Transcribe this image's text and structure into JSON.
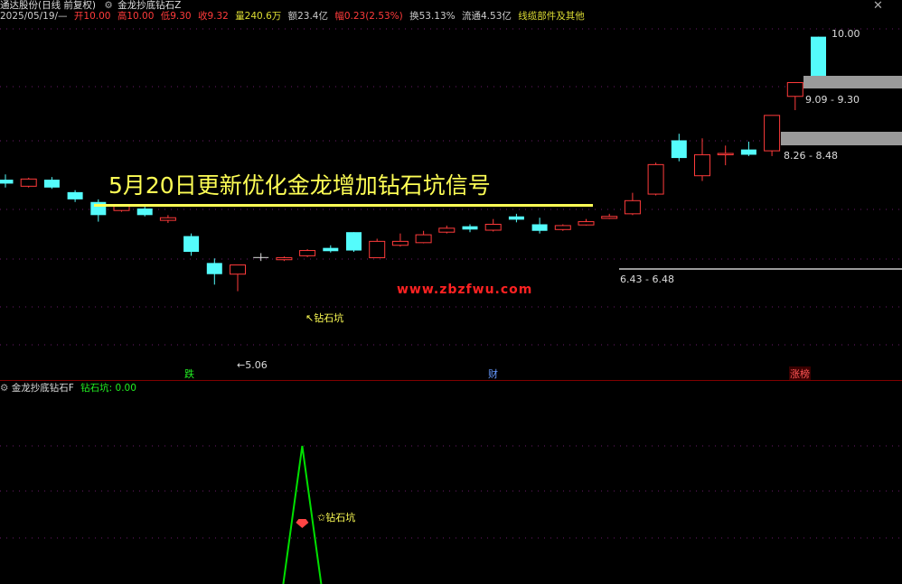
{
  "header": {
    "title_left": "通达股份(日线 前复权)",
    "indicator_name": "金龙抄底钻石Z",
    "date": "2025/05/19/—",
    "open": "开10.00",
    "high": "高10.00",
    "low": "低9.30",
    "close": "收9.32",
    "volume": "量240.6万",
    "amount": "额23.4亿",
    "change": "幅0.23(2.53%)",
    "turnover": "换53.13%",
    "float": "流通4.53亿",
    "industry": "线缆部件及其他"
  },
  "banner": "5月20日更新优化金龙增加钻石坑信号",
  "watermark": "www.zbzfwu.com",
  "price_labels": {
    "high_price": "10.00",
    "range_top": "9.09 - 9.30",
    "range_mid": "8.26 - 8.48",
    "range_low": "6.43 - 6.48",
    "low_price": "←5.06"
  },
  "signal_label": "钻石坑",
  "event_markers": {
    "die": "跌",
    "cai": "财",
    "zhangbang": "涨榜"
  },
  "lower_panel": {
    "name": "金龙抄底钻石F",
    "value": "钻石坑: 0.00",
    "signal_label": "钻石坑"
  },
  "colors": {
    "up": "#ff3b3b",
    "down": "#54fcfc",
    "gold": "#ffff55",
    "indicator_line": "#00e000",
    "separator": "#800000"
  },
  "chart_data": {
    "type": "candlestick",
    "candles": [
      {
        "open": 7.82,
        "close": 7.76,
        "high": 7.9,
        "low": 7.7
      },
      {
        "open": 7.72,
        "close": 7.83,
        "high": 7.85,
        "low": 7.7
      },
      {
        "open": 7.82,
        "close": 7.7,
        "high": 7.86,
        "low": 7.68
      },
      {
        "open": 7.63,
        "close": 7.52,
        "high": 7.66,
        "low": 7.48
      },
      {
        "open": 7.48,
        "close": 7.28,
        "high": 7.52,
        "low": 7.18
      },
      {
        "open": 7.35,
        "close": 7.42,
        "high": 7.44,
        "low": 7.33
      },
      {
        "open": 7.38,
        "close": 7.28,
        "high": 7.42,
        "low": 7.26
      },
      {
        "open": 7.2,
        "close": 7.24,
        "high": 7.28,
        "low": 7.16
      },
      {
        "open": 6.96,
        "close": 6.72,
        "high": 7.0,
        "low": 6.66
      },
      {
        "open": 6.55,
        "close": 6.38,
        "high": 6.62,
        "low": 6.22
      },
      {
        "open": 6.38,
        "close": 6.52,
        "high": 6.52,
        "low": 6.12
      },
      {
        "open": 6.64,
        "close": 6.64,
        "high": 6.7,
        "low": 6.58
      },
      {
        "open": 6.6,
        "close": 6.63,
        "high": 6.65,
        "low": 6.58
      },
      {
        "open": 6.66,
        "close": 6.74,
        "high": 6.76,
        "low": 6.64
      },
      {
        "open": 6.78,
        "close": 6.73,
        "high": 6.82,
        "low": 6.71
      },
      {
        "open": 7.02,
        "close": 6.74,
        "high": 7.02,
        "low": 6.72
      },
      {
        "open": 6.63,
        "close": 6.88,
        "high": 6.92,
        "low": 6.63
      },
      {
        "open": 6.82,
        "close": 6.88,
        "high": 7.0,
        "low": 6.8
      },
      {
        "open": 6.86,
        "close": 6.98,
        "high": 7.04,
        "low": 6.85
      },
      {
        "open": 7.02,
        "close": 7.08,
        "high": 7.12,
        "low": 7.0
      },
      {
        "open": 7.11,
        "close": 7.06,
        "high": 7.14,
        "low": 7.02
      },
      {
        "open": 7.05,
        "close": 7.14,
        "high": 7.22,
        "low": 7.03
      },
      {
        "open": 7.26,
        "close": 7.21,
        "high": 7.3,
        "low": 7.17
      },
      {
        "open": 7.14,
        "close": 7.04,
        "high": 7.24,
        "low": 7.0
      },
      {
        "open": 7.06,
        "close": 7.12,
        "high": 7.14,
        "low": 7.04
      },
      {
        "open": 7.13,
        "close": 7.18,
        "high": 7.22,
        "low": 7.12
      },
      {
        "open": 7.23,
        "close": 7.26,
        "high": 7.3,
        "low": 7.22
      },
      {
        "open": 7.3,
        "close": 7.5,
        "high": 7.62,
        "low": 7.28
      },
      {
        "open": 7.6,
        "close": 8.05,
        "high": 8.08,
        "low": 7.58
      },
      {
        "open": 8.42,
        "close": 8.15,
        "high": 8.52,
        "low": 8.1
      },
      {
        "open": 7.88,
        "close": 8.2,
        "high": 8.45,
        "low": 7.8
      },
      {
        "open": 8.2,
        "close": 8.22,
        "high": 8.34,
        "low": 8.04
      },
      {
        "open": 8.28,
        "close": 8.2,
        "high": 8.4,
        "low": 8.18
      },
      {
        "open": 8.26,
        "close": 8.8,
        "high": 8.8,
        "low": 8.18
      },
      {
        "open": 9.09,
        "close": 9.3,
        "high": 9.3,
        "low": 8.88
      },
      {
        "open": 10.0,
        "close": 9.32,
        "high": 10.0,
        "low": 9.3
      }
    ],
    "ylim": [
      5.0,
      10.05
    ],
    "indicator": {
      "type": "line",
      "peak_index": 12,
      "peak_value": 1.0
    }
  }
}
